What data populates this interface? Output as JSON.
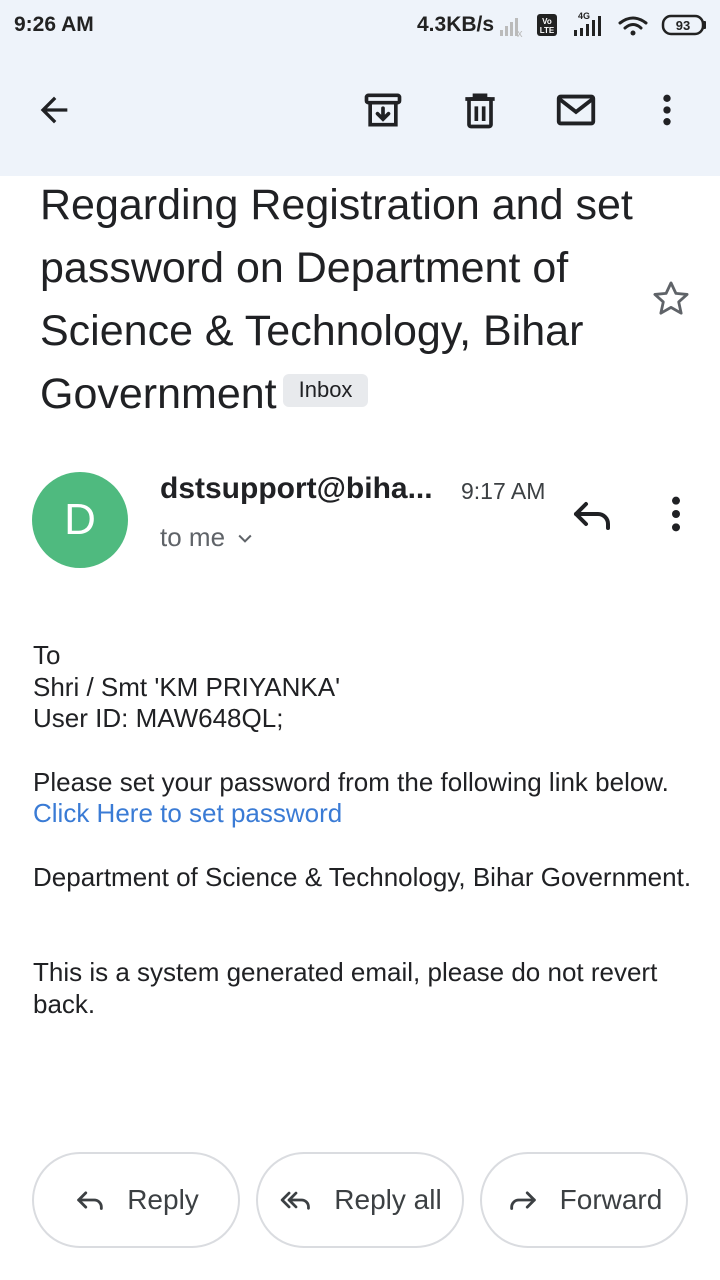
{
  "status_bar": {
    "time": "9:26 AM",
    "net_speed": "4.3KB/s",
    "network_badge": "4G",
    "volte_badge": "Vo LTE",
    "battery_level": "93"
  },
  "app_bar": {
    "icons": [
      "back-arrow-icon",
      "archive-icon",
      "delete-icon",
      "mark-unread-icon",
      "more-vert-icon"
    ]
  },
  "email": {
    "subject": "Regarding Registration and set password on Department of Science & Technology, Bihar Government",
    "label": "Inbox",
    "sender": "dstsupport@biha...",
    "avatar_initial": "D",
    "avatar_color": "#4fba7f",
    "time": "9:17 AM",
    "recipient": "to me",
    "body": {
      "line_to": "To",
      "line_name": "Shri / Smt 'KM PRIYANKA'",
      "line_userid": "User ID: MAW648QL;",
      "instruction": "Please set your password from the following link below.",
      "link_text": "Click Here to set password",
      "signature": "Department of Science & Technology, Bihar Government.",
      "footer": "This is a system generated email, please do not revert back."
    }
  },
  "actions": {
    "reply": "Reply",
    "reply_all": "Reply all",
    "forward": "Forward"
  },
  "colors": {
    "app_bar_bg": "#eef3fa",
    "link": "#3a7bd5"
  }
}
